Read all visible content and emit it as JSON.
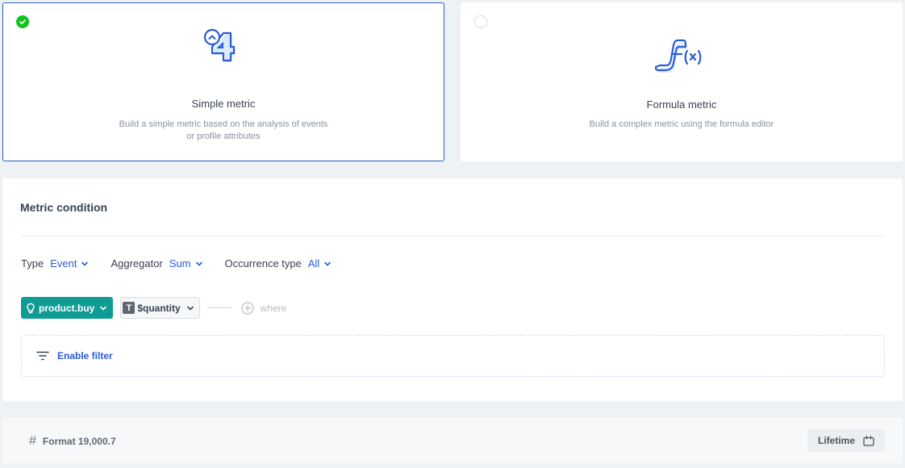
{
  "metric_types": [
    {
      "id": "simple",
      "title": "Simple metric",
      "description": "Build a simple metric based on the analysis of events or profile attributes",
      "selected": true,
      "icon": "simple-metric-illustration-icon"
    },
    {
      "id": "formula",
      "title": "Formula metric",
      "description": "Build a complex metric using the formula editor",
      "selected": false,
      "icon": "formula-metric-illustration-icon"
    }
  ],
  "condition": {
    "title": "Metric condition",
    "type": {
      "label": "Type",
      "value": "Event"
    },
    "aggregator": {
      "label": "Aggregator",
      "value": "Sum"
    },
    "occurrence": {
      "label": "Occurrence type",
      "value": "All"
    },
    "event_chip": {
      "label": "product.buy",
      "icon": "event-bulb-icon"
    },
    "param_chip": {
      "badge": "T",
      "label": "$quantity"
    },
    "where_label": "where",
    "filter_label": "Enable filter"
  },
  "footer": {
    "format_label": "Format 19,000.7",
    "format_icon": "#",
    "date_range_label": "Lifetime"
  },
  "colors": {
    "accent_blue": "#2a5bd7",
    "selected_border": "#2d5dc4",
    "check_green": "#0fc41f",
    "event_teal": "#0f9c94"
  }
}
